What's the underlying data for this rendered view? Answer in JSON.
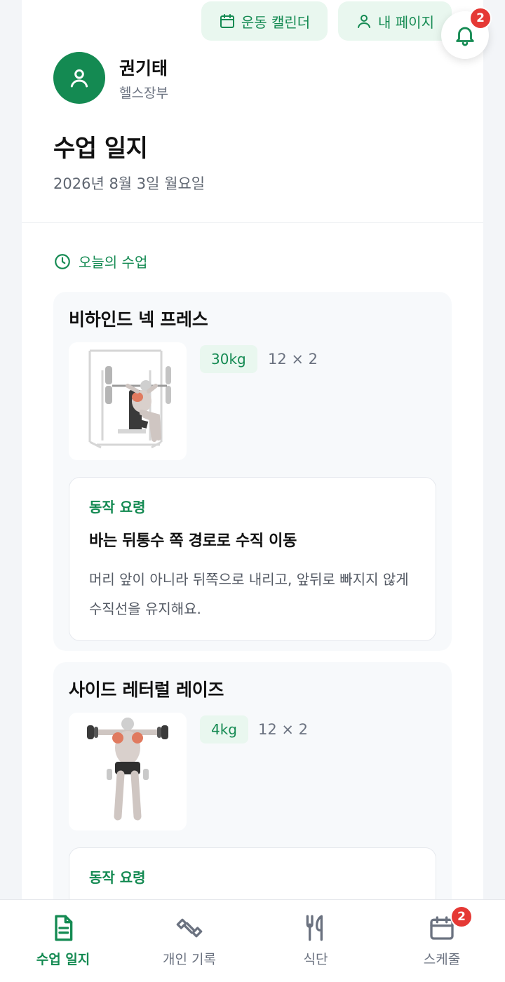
{
  "header": {
    "calendar_button": "운동 캘린더",
    "mypage_button": "내 페이지",
    "notification_count": "2"
  },
  "profile": {
    "name": "권기태",
    "role": "헬스장부"
  },
  "page": {
    "title": "수업 일지",
    "date": "2026년 8월 3일 월요일"
  },
  "section": {
    "title": "오늘의 수업"
  },
  "exercises": [
    {
      "name": "비하인드 넥 프레스",
      "weight": "30kg",
      "reps": "12 × 2",
      "tip_label": "동작 요령",
      "tip_title": "바는 뒤통수 쪽 경로로 수직 이동",
      "tip_desc": "머리 앞이 아니라 뒤쪽으로 내리고, 앞뒤로 빠지지 않게 수직선을 유지해요."
    },
    {
      "name": "사이드 레터럴 레이즈",
      "weight": "4kg",
      "reps": "12 × 2",
      "tip_label": "동작 요령"
    }
  ],
  "bottom_nav": [
    {
      "label": "수업 일지",
      "icon": "document-icon",
      "active": true
    },
    {
      "label": "개인 기록",
      "icon": "dumbbell-icon",
      "active": false
    },
    {
      "label": "식단",
      "icon": "utensils-icon",
      "active": false
    },
    {
      "label": "스케줄",
      "icon": "calendar-icon",
      "active": false,
      "badge": "2"
    }
  ],
  "colors": {
    "accent": "#148a52",
    "badge": "#e53935"
  }
}
